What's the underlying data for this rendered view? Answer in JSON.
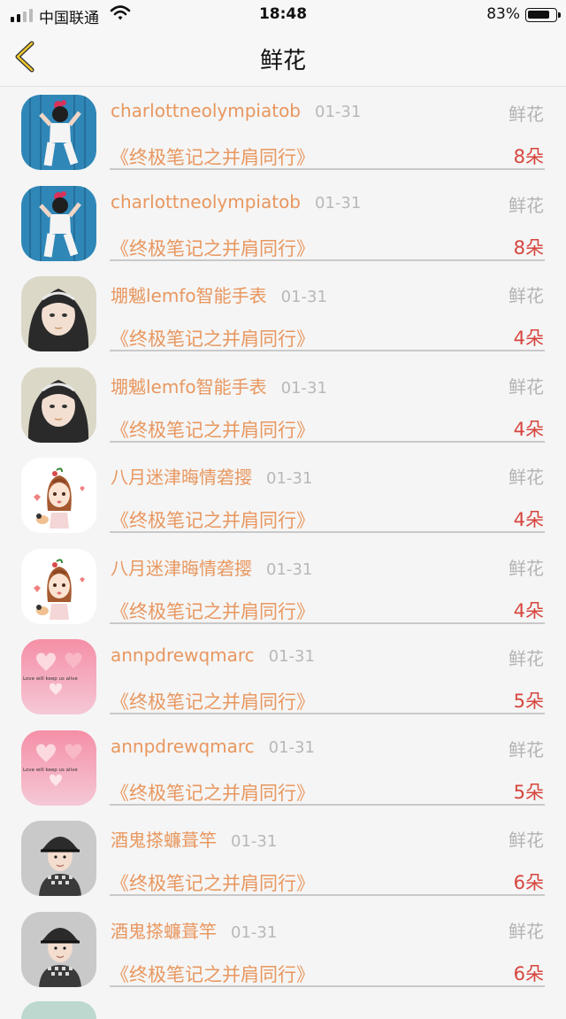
{
  "status": {
    "carrier": "中国联通",
    "time": "18:48",
    "battery_pct": "83%",
    "battery_level": 0.83
  },
  "nav": {
    "title": "鲜花"
  },
  "rows": [
    {
      "name": "charlottneolympiatob",
      "date": "01-31",
      "type": "鲜花",
      "book": "《终极笔记之并肩同行》",
      "count": "8朵",
      "avatar": "girl-blue-wall"
    },
    {
      "name": "charlottneolympiatob",
      "date": "01-31",
      "type": "鲜花",
      "book": "《终极笔记之并肩同行》",
      "count": "8朵",
      "avatar": "girl-blue-wall"
    },
    {
      "name": "堋魆lemfo智能手表",
      "date": "01-31",
      "type": "鲜花",
      "book": "《终极笔记之并肩同行》",
      "count": "4朵",
      "avatar": "girl-headband"
    },
    {
      "name": "堋魆lemfo智能手表",
      "date": "01-31",
      "type": "鲜花",
      "book": "《终极笔记之并肩同行》",
      "count": "4朵",
      "avatar": "girl-headband"
    },
    {
      "name": "八月迷津晦情砻撄",
      "date": "01-31",
      "type": "鲜花",
      "book": "《终极笔记之并肩同行》",
      "count": "4朵",
      "avatar": "cartoon-girl"
    },
    {
      "name": "八月迷津晦情砻撄",
      "date": "01-31",
      "type": "鲜花",
      "book": "《终极笔记之并肩同行》",
      "count": "4朵",
      "avatar": "cartoon-girl"
    },
    {
      "name": "annpdrewqmarc",
      "date": "01-31",
      "type": "鲜花",
      "book": "《终极笔记之并肩同行》",
      "count": "5朵",
      "avatar": "pink-hearts"
    },
    {
      "name": "annpdrewqmarc",
      "date": "01-31",
      "type": "鲜花",
      "book": "《终极笔记之并肩同行》",
      "count": "5朵",
      "avatar": "pink-hearts"
    },
    {
      "name": "酒鬼搽蠊葺竿",
      "date": "01-31",
      "type": "鲜花",
      "book": "《终极笔记之并肩同行》",
      "count": "6朵",
      "avatar": "boy-cap"
    },
    {
      "name": "酒鬼搽蠊葺竿",
      "date": "01-31",
      "type": "鲜花",
      "book": "《终极笔记之并肩同行》",
      "count": "6朵",
      "avatar": "boy-cap"
    }
  ],
  "avatar_text": {
    "pink-hearts": "Love will keep us alive"
  }
}
